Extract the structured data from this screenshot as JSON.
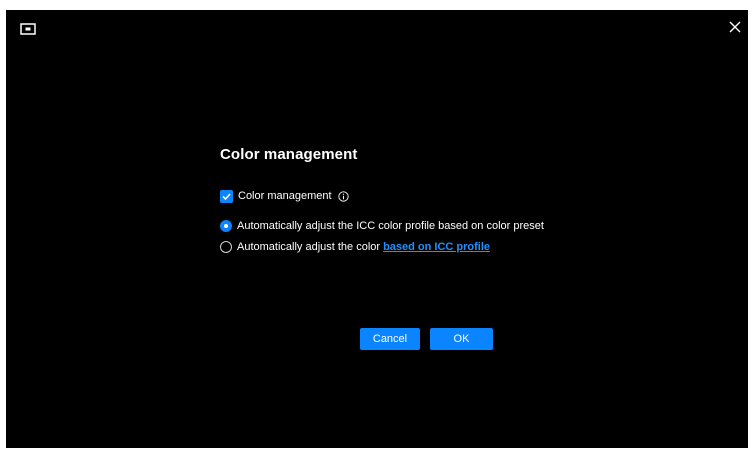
{
  "window": {
    "app_icon": "monitor-icon",
    "close_icon": "close-icon"
  },
  "dialog": {
    "title": "Color management",
    "checkbox": {
      "label": "Color management",
      "checked": true,
      "info_icon": "info-icon"
    },
    "options": [
      {
        "label": "Automatically adjust the ICC color profile based on color preset",
        "selected": true
      },
      {
        "label": "Automatically adjust the color",
        "link_text": "based on ICC profile",
        "selected": false
      }
    ],
    "buttons": {
      "cancel": "Cancel",
      "ok": "OK"
    }
  },
  "colors": {
    "background": "#000000",
    "accent": "#0a84ff",
    "link": "#1e90ff"
  }
}
